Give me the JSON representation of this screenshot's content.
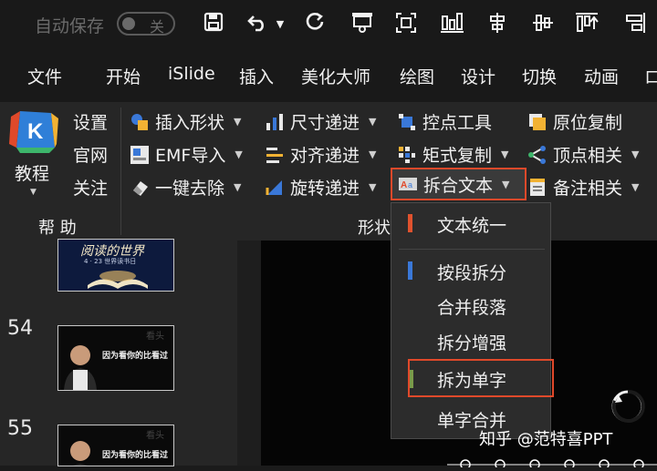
{
  "quick_access": {
    "autosave_label": "自动保存",
    "toggle_state": "关"
  },
  "menubar": {
    "items": [
      "文件",
      "开始",
      "iSlide",
      "插入",
      "美化大师",
      "绘图",
      "设计",
      "切换",
      "动画",
      "ロ"
    ]
  },
  "ribbon": {
    "help_group": {
      "big_button": "教程",
      "items": [
        "设置",
        "官网",
        "关注"
      ],
      "group_label": "帮 助"
    },
    "col1": [
      "插入形状",
      "EMF导入",
      "一键去除"
    ],
    "col2": [
      "尺寸递进",
      "对齐递进",
      "旋转递进"
    ],
    "col3": [
      "控点工具",
      "矩式复制",
      "拆合文本"
    ],
    "col4": [
      "原位复制",
      "顶点相关",
      "备注相关"
    ],
    "shape_group_label": "形状"
  },
  "slides": {
    "numbers": [
      "54",
      "55"
    ],
    "thumb_top_caption": "阅读的世界",
    "thumb_top_sub": "4 · 23  世界读书日",
    "thumb_caption": "因为看你的比看过",
    "thumb_watermark": "看头"
  },
  "dropdown": {
    "items": [
      "文本统一",
      "按段拆分",
      "合并段落",
      "拆分增强",
      "拆为单字",
      "单字合并"
    ]
  },
  "watermark": "知乎 @范特喜PPT",
  "colors": {
    "highlight": "#e0492a",
    "orange_bar": "#e0522e",
    "blue_bar": "#3a78d8",
    "green_bar": "#7a9a4a"
  }
}
